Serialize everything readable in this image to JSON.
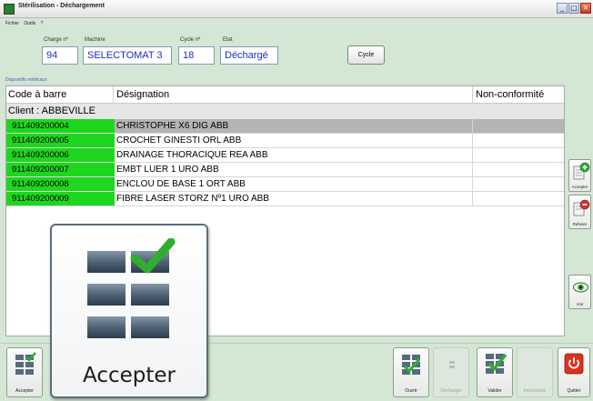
{
  "window": {
    "title": "Stérilisation - Déchargement"
  },
  "menu": [
    "Fichier",
    "Outils",
    "?"
  ],
  "header": {
    "charge_label": "Charge nº",
    "charge_value": "94",
    "machine_label": "Machine",
    "machine_value": "SELECTOMAT 3",
    "cycle_label": "Cycle nº",
    "cycle_value": "18",
    "etat_label": "Etat",
    "etat_value": "Déchargé",
    "cycle_button": "Cycle"
  },
  "group_title": "Dispositifs médicaux",
  "table": {
    "columns": [
      "Code à barre",
      "Désignation",
      "Non-conformité"
    ],
    "client": "Client : ABBEVILLE",
    "rows": [
      {
        "code": "911409200004",
        "designation": "CHRISTOPHE X6 DIG ABB",
        "nc": ""
      },
      {
        "code": "911409200005",
        "designation": "CROCHET GINESTI ORL ABB",
        "nc": ""
      },
      {
        "code": "911409200006",
        "designation": "DRAINAGE THORACIQUE REA ABB",
        "nc": ""
      },
      {
        "code": "911409200007",
        "designation": "EMBT LUER 1 URO ABB",
        "nc": ""
      },
      {
        "code": "911409200008",
        "designation": "ENCLOU DE BASE 1 ORT ABB",
        "nc": ""
      },
      {
        "code": "911409200009",
        "designation": "FIBRE LASER STORZ Nº1 URO ABB",
        "nc": ""
      }
    ],
    "selected_row": 0
  },
  "side_buttons": {
    "accept": "Accepter",
    "refuse": "Refuser",
    "view": "Voir"
  },
  "toolbar": {
    "accept": "Accepter",
    "open": "Ouvrir",
    "unload": "Décharger",
    "validate": "Valider",
    "print": "Impression",
    "quit": "Quitter"
  },
  "tooltip": {
    "label": "Accepter"
  },
  "colors": {
    "barcode_bg": "#1ed61e",
    "field_text": "#1a2fc7",
    "background": "#d4e6d4"
  }
}
